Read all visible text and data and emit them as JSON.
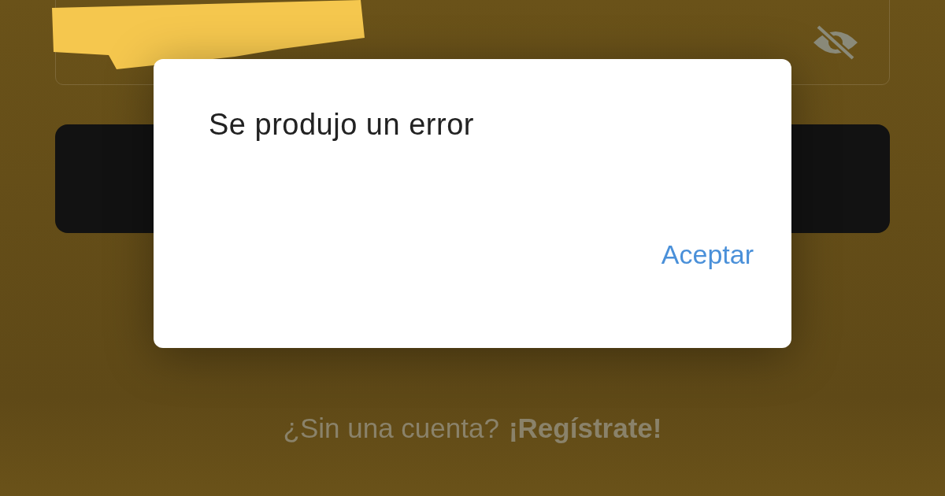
{
  "password_field": {
    "masked": true
  },
  "dialog": {
    "message": "Se produjo un error",
    "buttons": [
      "Aceptar"
    ]
  },
  "signup": {
    "prompt": "¿Sin una cuenta?",
    "link": "¡Regístrate!"
  }
}
